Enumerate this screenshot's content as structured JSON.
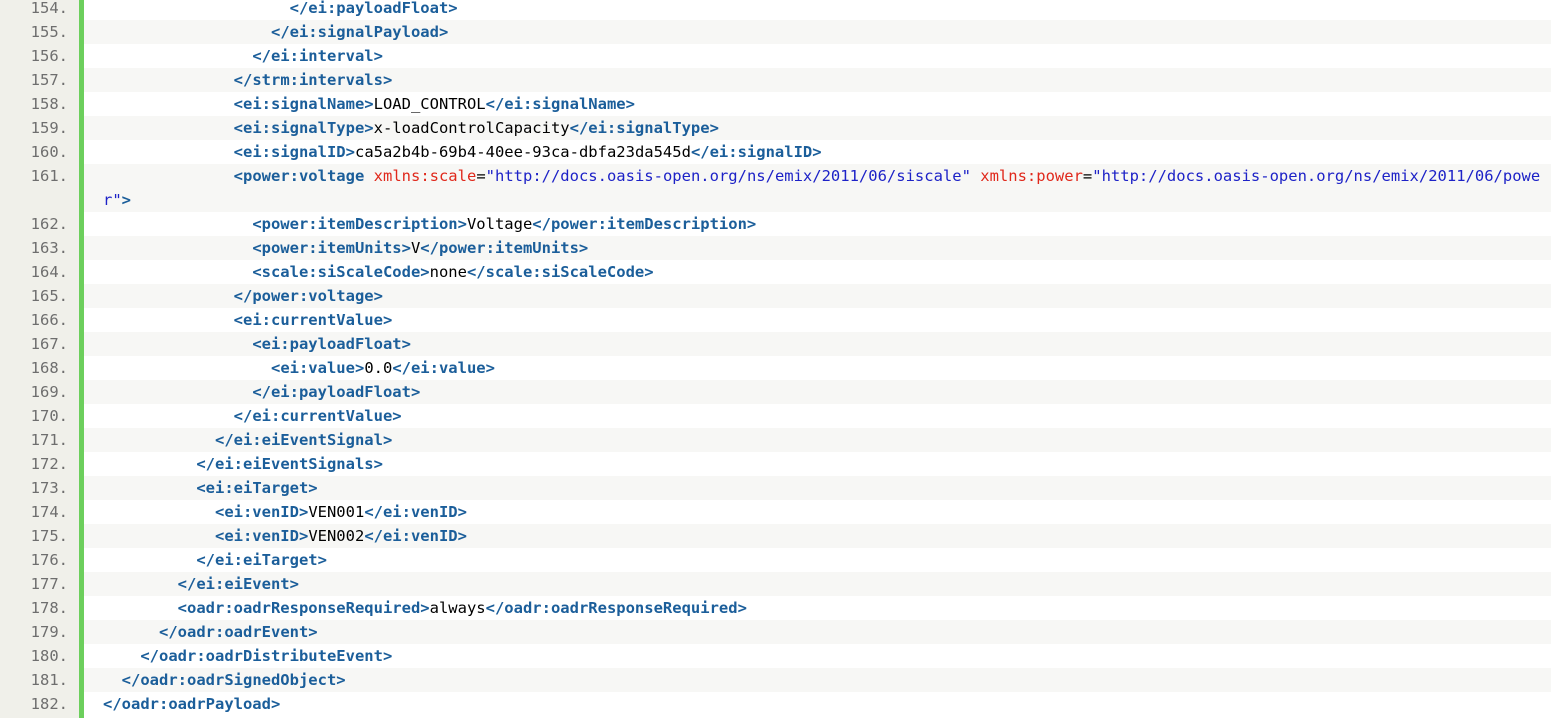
{
  "colors": {
    "tag": "#1b5e9a",
    "attribute": "#e0281b",
    "attribute_value": "#1d22c7",
    "text": "#000000",
    "gutter_background": "#f0f0ea",
    "gutter_bar": "#6ccf5c",
    "line_number": "#6e6e6e"
  },
  "lines": [
    {
      "number": "154.",
      "indent": 10,
      "tokens": [
        {
          "type": "tag",
          "text": "</ei:payloadFloat>"
        }
      ]
    },
    {
      "number": "155.",
      "indent": 9,
      "tokens": [
        {
          "type": "tag",
          "text": "</ei:signalPayload>"
        }
      ]
    },
    {
      "number": "156.",
      "indent": 8,
      "tokens": [
        {
          "type": "tag",
          "text": "</ei:interval>"
        }
      ]
    },
    {
      "number": "157.",
      "indent": 7,
      "tokens": [
        {
          "type": "tag",
          "text": "</strm:intervals>"
        }
      ]
    },
    {
      "number": "158.",
      "indent": 7,
      "tokens": [
        {
          "type": "tag",
          "text": "<ei:signalName>"
        },
        {
          "type": "txt",
          "text": "LOAD_CONTROL"
        },
        {
          "type": "tag",
          "text": "</ei:signalName>"
        }
      ]
    },
    {
      "number": "159.",
      "indent": 7,
      "tokens": [
        {
          "type": "tag",
          "text": "<ei:signalType>"
        },
        {
          "type": "txt",
          "text": "x-loadControlCapacity"
        },
        {
          "type": "tag",
          "text": "</ei:signalType>"
        }
      ]
    },
    {
      "number": "160.",
      "indent": 7,
      "tokens": [
        {
          "type": "tag",
          "text": "<ei:signalID>"
        },
        {
          "type": "txt",
          "text": "ca5a2b4b-69b4-40ee-93ca-dbfa23da545d"
        },
        {
          "type": "tag",
          "text": "</ei:signalID>"
        }
      ]
    },
    {
      "number": "161.",
      "indent": 7,
      "tokens": [
        {
          "type": "tag",
          "text": "<power:voltage"
        },
        {
          "type": "txt",
          "text": " "
        },
        {
          "type": "attr",
          "text": "xmlns:scale"
        },
        {
          "type": "txt",
          "text": "="
        },
        {
          "type": "val",
          "text": "\"http://docs.oasis-open.org/ns/emix/2011/06/siscale\""
        },
        {
          "type": "txt",
          "text": " "
        },
        {
          "type": "attr",
          "text": "xmlns:power"
        },
        {
          "type": "txt",
          "text": "="
        },
        {
          "type": "val",
          "text": "\"http://docs.oasis-open.org/ns/emix/2011/06/power\""
        },
        {
          "type": "tag",
          "text": ">"
        }
      ]
    },
    {
      "number": "162.",
      "indent": 8,
      "tokens": [
        {
          "type": "tag",
          "text": "<power:itemDescription>"
        },
        {
          "type": "txt",
          "text": "Voltage"
        },
        {
          "type": "tag",
          "text": "</power:itemDescription>"
        }
      ]
    },
    {
      "number": "163.",
      "indent": 8,
      "tokens": [
        {
          "type": "tag",
          "text": "<power:itemUnits>"
        },
        {
          "type": "txt",
          "text": "V"
        },
        {
          "type": "tag",
          "text": "</power:itemUnits>"
        }
      ]
    },
    {
      "number": "164.",
      "indent": 8,
      "tokens": [
        {
          "type": "tag",
          "text": "<scale:siScaleCode>"
        },
        {
          "type": "txt",
          "text": "none"
        },
        {
          "type": "tag",
          "text": "</scale:siScaleCode>"
        }
      ]
    },
    {
      "number": "165.",
      "indent": 7,
      "tokens": [
        {
          "type": "tag",
          "text": "</power:voltage>"
        }
      ]
    },
    {
      "number": "166.",
      "indent": 7,
      "tokens": [
        {
          "type": "tag",
          "text": "<ei:currentValue>"
        }
      ]
    },
    {
      "number": "167.",
      "indent": 8,
      "tokens": [
        {
          "type": "tag",
          "text": "<ei:payloadFloat>"
        }
      ]
    },
    {
      "number": "168.",
      "indent": 9,
      "tokens": [
        {
          "type": "tag",
          "text": "<ei:value>"
        },
        {
          "type": "txt",
          "text": "0.0"
        },
        {
          "type": "tag",
          "text": "</ei:value>"
        }
      ]
    },
    {
      "number": "169.",
      "indent": 8,
      "tokens": [
        {
          "type": "tag",
          "text": "</ei:payloadFloat>"
        }
      ]
    },
    {
      "number": "170.",
      "indent": 7,
      "tokens": [
        {
          "type": "tag",
          "text": "</ei:currentValue>"
        }
      ]
    },
    {
      "number": "171.",
      "indent": 6,
      "tokens": [
        {
          "type": "tag",
          "text": "</ei:eiEventSignal>"
        }
      ]
    },
    {
      "number": "172.",
      "indent": 5,
      "tokens": [
        {
          "type": "tag",
          "text": "</ei:eiEventSignals>"
        }
      ]
    },
    {
      "number": "173.",
      "indent": 5,
      "tokens": [
        {
          "type": "tag",
          "text": "<ei:eiTarget>"
        }
      ]
    },
    {
      "number": "174.",
      "indent": 6,
      "tokens": [
        {
          "type": "tag",
          "text": "<ei:venID>"
        },
        {
          "type": "txt",
          "text": "VEN001"
        },
        {
          "type": "tag",
          "text": "</ei:venID>"
        }
      ]
    },
    {
      "number": "175.",
      "indent": 6,
      "tokens": [
        {
          "type": "tag",
          "text": "<ei:venID>"
        },
        {
          "type": "txt",
          "text": "VEN002"
        },
        {
          "type": "tag",
          "text": "</ei:venID>"
        }
      ]
    },
    {
      "number": "176.",
      "indent": 5,
      "tokens": [
        {
          "type": "tag",
          "text": "</ei:eiTarget>"
        }
      ]
    },
    {
      "number": "177.",
      "indent": 4,
      "tokens": [
        {
          "type": "tag",
          "text": "</ei:eiEvent>"
        }
      ]
    },
    {
      "number": "178.",
      "indent": 4,
      "tokens": [
        {
          "type": "tag",
          "text": "<oadr:oadrResponseRequired>"
        },
        {
          "type": "txt",
          "text": "always"
        },
        {
          "type": "tag",
          "text": "</oadr:oadrResponseRequired>"
        }
      ]
    },
    {
      "number": "179.",
      "indent": 3,
      "tokens": [
        {
          "type": "tag",
          "text": "</oadr:oadrEvent>"
        }
      ]
    },
    {
      "number": "180.",
      "indent": 2,
      "tokens": [
        {
          "type": "tag",
          "text": "</oadr:oadrDistributeEvent>"
        }
      ]
    },
    {
      "number": "181.",
      "indent": 1,
      "tokens": [
        {
          "type": "tag",
          "text": "</oadr:oadrSignedObject>"
        }
      ]
    },
    {
      "number": "182.",
      "indent": 0,
      "tokens": [
        {
          "type": "tag",
          "text": "</oadr:oadrPayload>"
        }
      ]
    }
  ]
}
